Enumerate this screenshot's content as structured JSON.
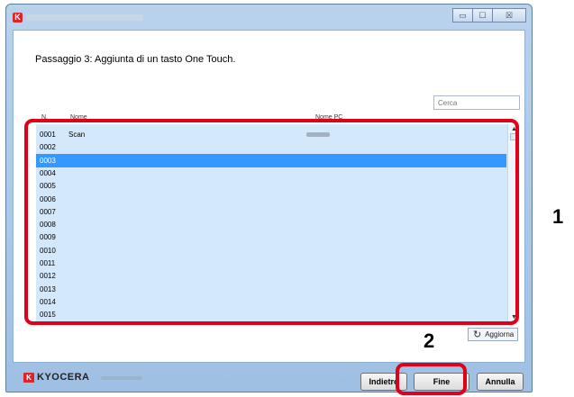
{
  "window": {
    "close_glyph": "☒",
    "minimize_glyph": "▭",
    "maximize_glyph": "☐"
  },
  "step_title": "Passaggio 3: Aggiunta di un tasto One Touch.",
  "search": {
    "placeholder": "Cerca"
  },
  "table": {
    "columns": {
      "n": "N.",
      "name": "Nome",
      "pc": "Nome PC"
    },
    "rows": [
      {
        "num": "0001",
        "name": "Scan",
        "selected": false
      },
      {
        "num": "0002",
        "name": "",
        "selected": false
      },
      {
        "num": "0003",
        "name": "",
        "selected": true
      },
      {
        "num": "0004",
        "name": "",
        "selected": false
      },
      {
        "num": "0005",
        "name": "",
        "selected": false
      },
      {
        "num": "0006",
        "name": "",
        "selected": false
      },
      {
        "num": "0007",
        "name": "",
        "selected": false
      },
      {
        "num": "0008",
        "name": "",
        "selected": false
      },
      {
        "num": "0009",
        "name": "",
        "selected": false
      },
      {
        "num": "0010",
        "name": "",
        "selected": false
      },
      {
        "num": "0011",
        "name": "",
        "selected": false
      },
      {
        "num": "0012",
        "name": "",
        "selected": false
      },
      {
        "num": "0013",
        "name": "",
        "selected": false
      },
      {
        "num": "0014",
        "name": "",
        "selected": false
      },
      {
        "num": "0015",
        "name": "",
        "selected": false
      }
    ]
  },
  "refresh_button": {
    "label": "Aggiorna",
    "icon": "refresh-icon",
    "glyph": "↻"
  },
  "footer": {
    "logo_text": "KYOCERA",
    "logo_mark_glyph": "K",
    "back_label": "Indietro",
    "finish_label": "Fine",
    "cancel_label": "Annulla"
  },
  "callouts": {
    "one": "1",
    "two": "2"
  },
  "colors": {
    "highlight": "#e0001a",
    "selection": "#3399ff",
    "list_bg": "#d4e8fb"
  }
}
